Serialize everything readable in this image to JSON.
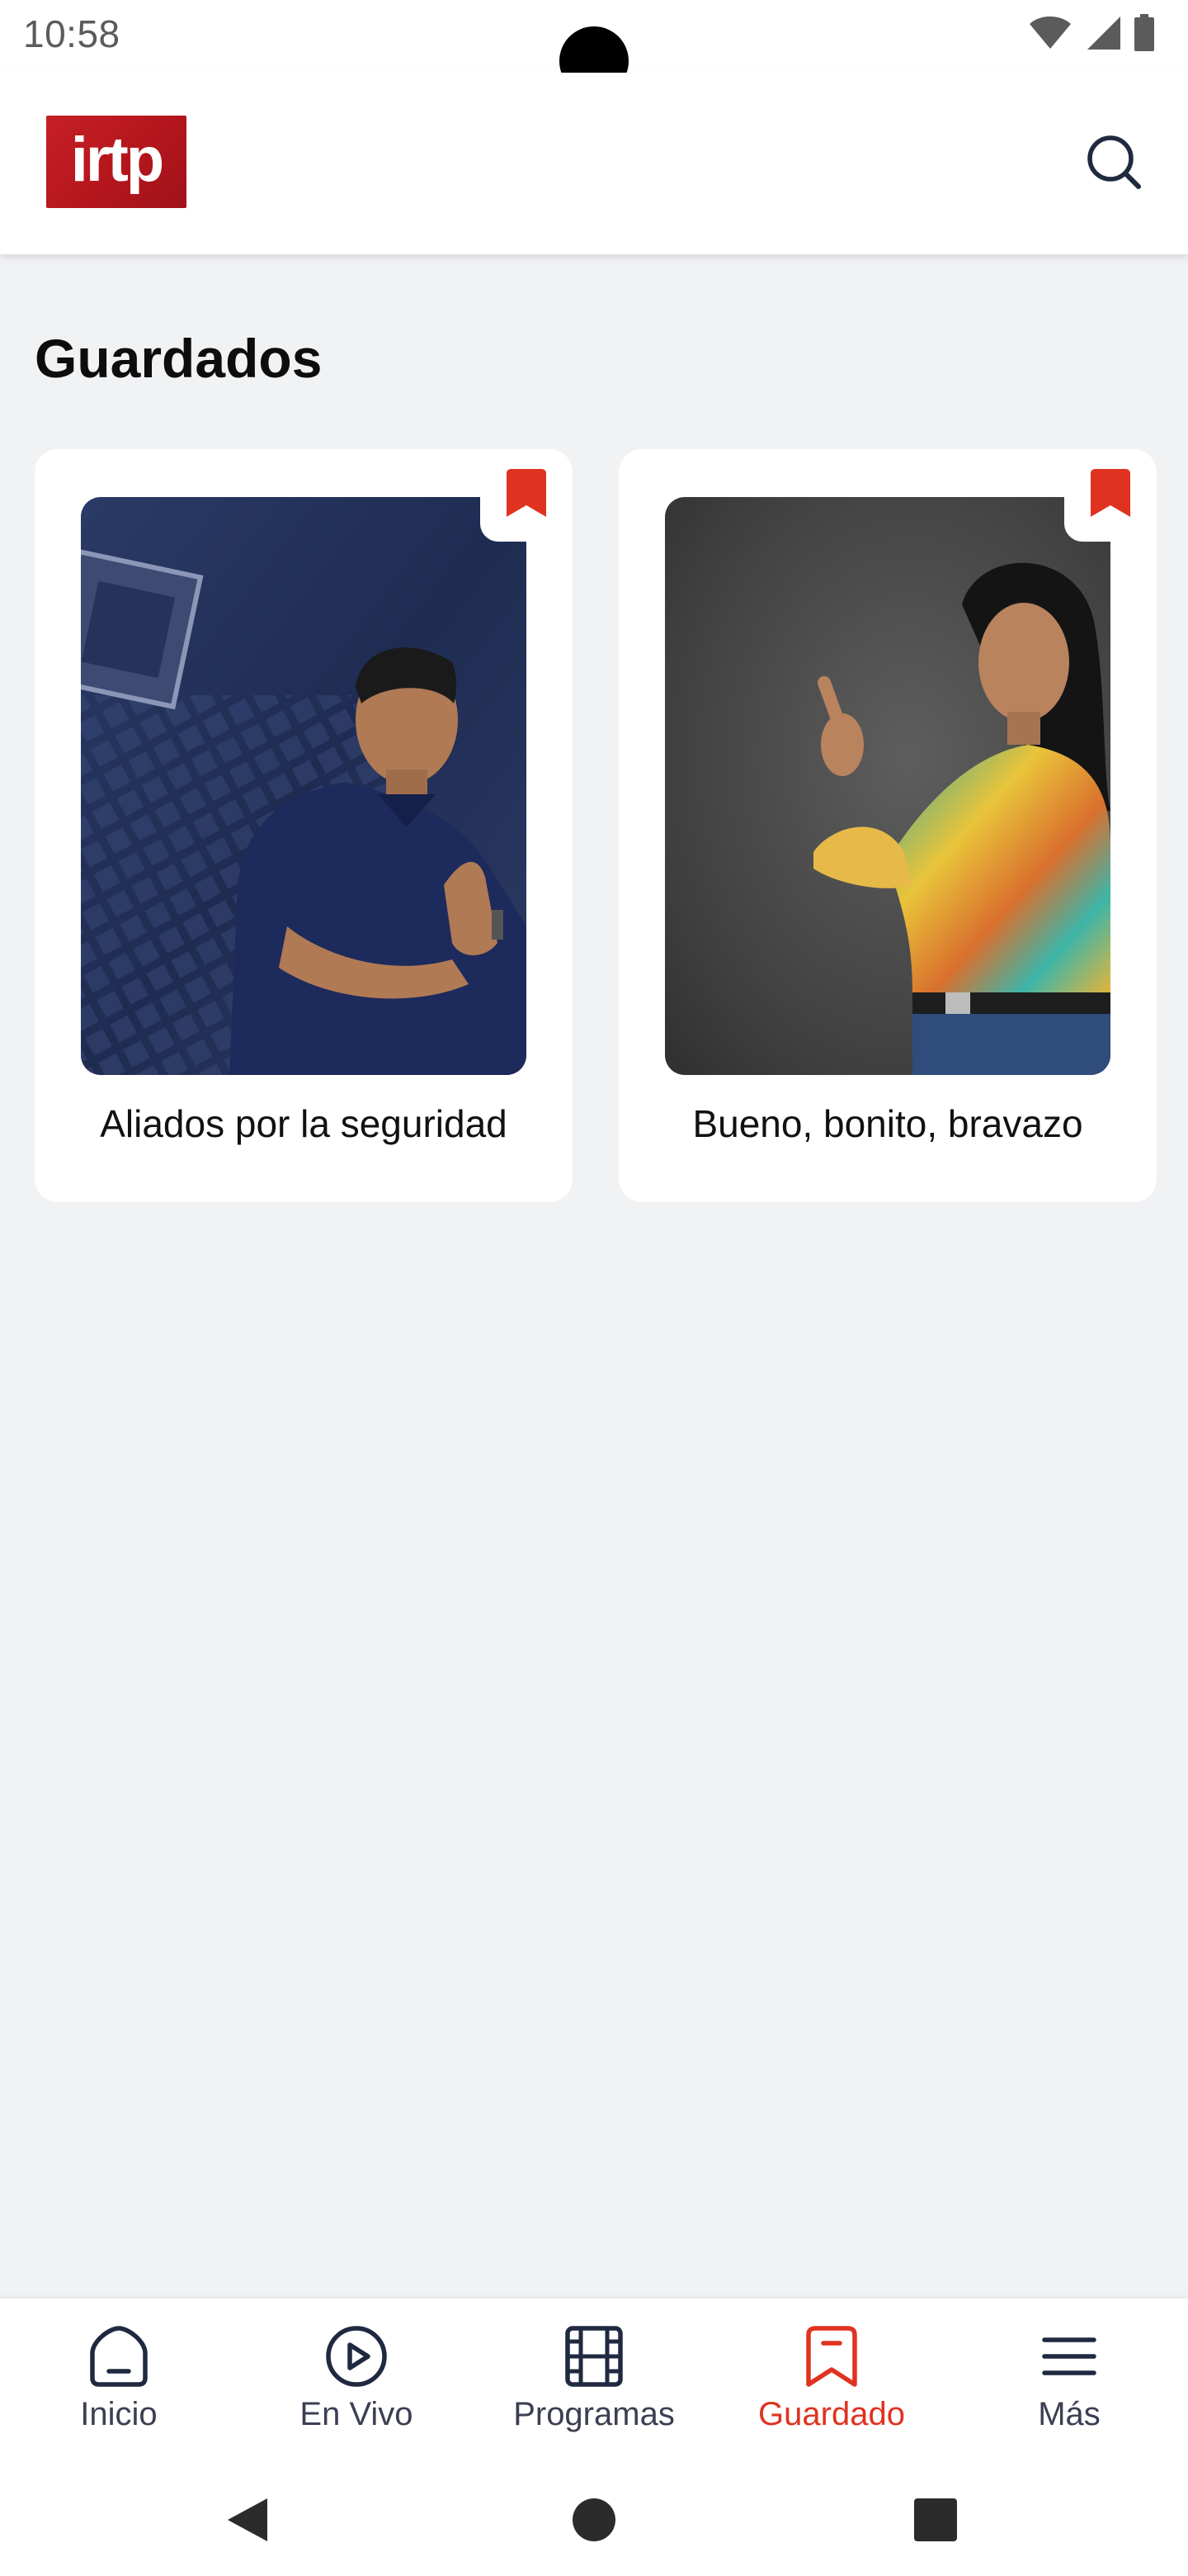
{
  "status_bar": {
    "time": "10:58",
    "icons": [
      "wifi-icon",
      "cellular-signal-icon",
      "battery-icon"
    ]
  },
  "header": {
    "logo_text": "irtp",
    "search_icon": "search-icon",
    "brand_color": "#C62026"
  },
  "page": {
    "title": "Guardados"
  },
  "cards": [
    {
      "title": "Aliados por la seguridad",
      "bookmark_icon": "bookmark-filled-icon",
      "image": "man-blue-polo-thumbs-up-aerial-city-background"
    },
    {
      "title": "Bueno, bonito, bravazo",
      "bookmark_icon": "bookmark-filled-icon",
      "image": "woman-colorful-blouse-pointing-chalkboard-background"
    }
  ],
  "bottom_nav": {
    "items": [
      {
        "label": "Inicio",
        "icon": "home-icon",
        "active": false
      },
      {
        "label": "En Vivo",
        "icon": "play-circle-icon",
        "active": false
      },
      {
        "label": "Programas",
        "icon": "film-strip-icon",
        "active": false
      },
      {
        "label": "Guardado",
        "icon": "bookmark-icon",
        "active": true
      },
      {
        "label": "Más",
        "icon": "menu-icon",
        "active": false
      }
    ],
    "active_color": "#E03221",
    "inactive_color": "#1F2940"
  },
  "system_nav": {
    "buttons": [
      "back-icon",
      "home-circle-icon",
      "recents-icon"
    ]
  }
}
